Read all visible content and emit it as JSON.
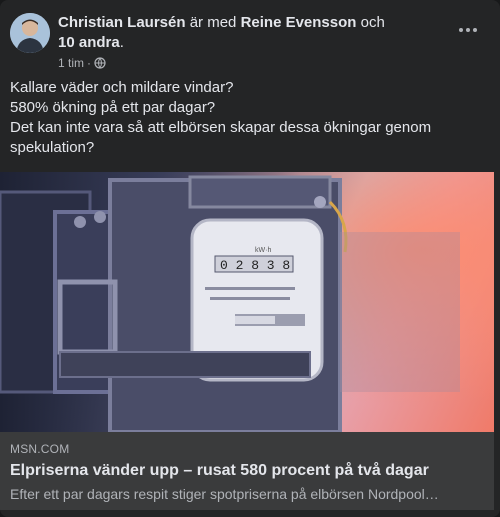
{
  "post": {
    "author": "Christian Laursén",
    "with_text": "är med",
    "tagged": "Reine Evensson",
    "and_text": "och",
    "others": "10 andra",
    "trailing_dot": ".",
    "time": "1 tim",
    "separator": "·",
    "privacy_icon": "globe-icon",
    "more_icon": "more-options-icon",
    "text_lines": [
      "Kallare väder och mildare vindar?",
      "580% ökning på ett par dagar?",
      "Det kan inte vara så att elbörsen skapar dessa ökningar genom spekulation?"
    ]
  },
  "link": {
    "image_label": "electricity-meter-photo",
    "meter_reading": "02838",
    "meter_top_label": "kW·h",
    "domain": "MSN.COM",
    "title": "Elpriserna vänder upp – rusat 580 procent på två dagar",
    "description": "Efter ett par dagars respit stiger spotpriserna på elbörsen Nordpool…"
  },
  "colors": {
    "card_bg": "#242526",
    "page_bg": "#18191a",
    "text_primary": "#e4e6eb",
    "text_secondary": "#b0b3b8",
    "link_footer_bg": "#3a3b3c"
  }
}
